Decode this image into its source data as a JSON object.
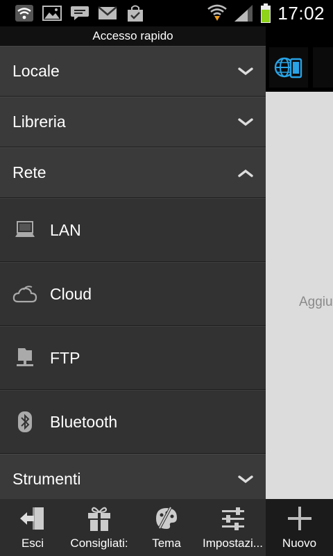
{
  "status_bar": {
    "time": "17:02",
    "left_icons": [
      "wifi-icon",
      "image-icon",
      "chat-icon",
      "gmail-icon",
      "shopping-bag-icon"
    ],
    "right_icons": [
      "wifi-download-icon",
      "signal-icon",
      "battery-icon"
    ]
  },
  "drawer": {
    "header": "Accesso rapido",
    "sections": [
      {
        "label": "Locale",
        "expanded": false
      },
      {
        "label": "Libreria",
        "expanded": false
      },
      {
        "label": "Rete",
        "expanded": true,
        "items": [
          {
            "label": "LAN",
            "icon": "computer-icon"
          },
          {
            "label": "Cloud",
            "icon": "cloud-icon"
          },
          {
            "label": "FTP",
            "icon": "ftp-server-icon"
          },
          {
            "label": "Bluetooth",
            "icon": "bluetooth-icon"
          }
        ]
      },
      {
        "label": "Strumenti",
        "expanded": false
      }
    ]
  },
  "background": {
    "tab_icon": "globe-phone-icon",
    "hint_text": "Aggiu"
  },
  "toolbar": {
    "buttons": [
      {
        "label": "Esci",
        "icon": "exit-icon"
      },
      {
        "label": "Consigliati:",
        "icon": "gift-icon"
      },
      {
        "label": "Tema",
        "icon": "palette-icon"
      },
      {
        "label": "Impostazi...",
        "icon": "settings-sliders-icon"
      },
      {
        "label": "Nuovo",
        "icon": "plus-icon"
      }
    ]
  },
  "colors": {
    "accent_blue": "#29a3e6",
    "battery_green": "#8fd31a",
    "download_arrow": "#f0a020"
  }
}
